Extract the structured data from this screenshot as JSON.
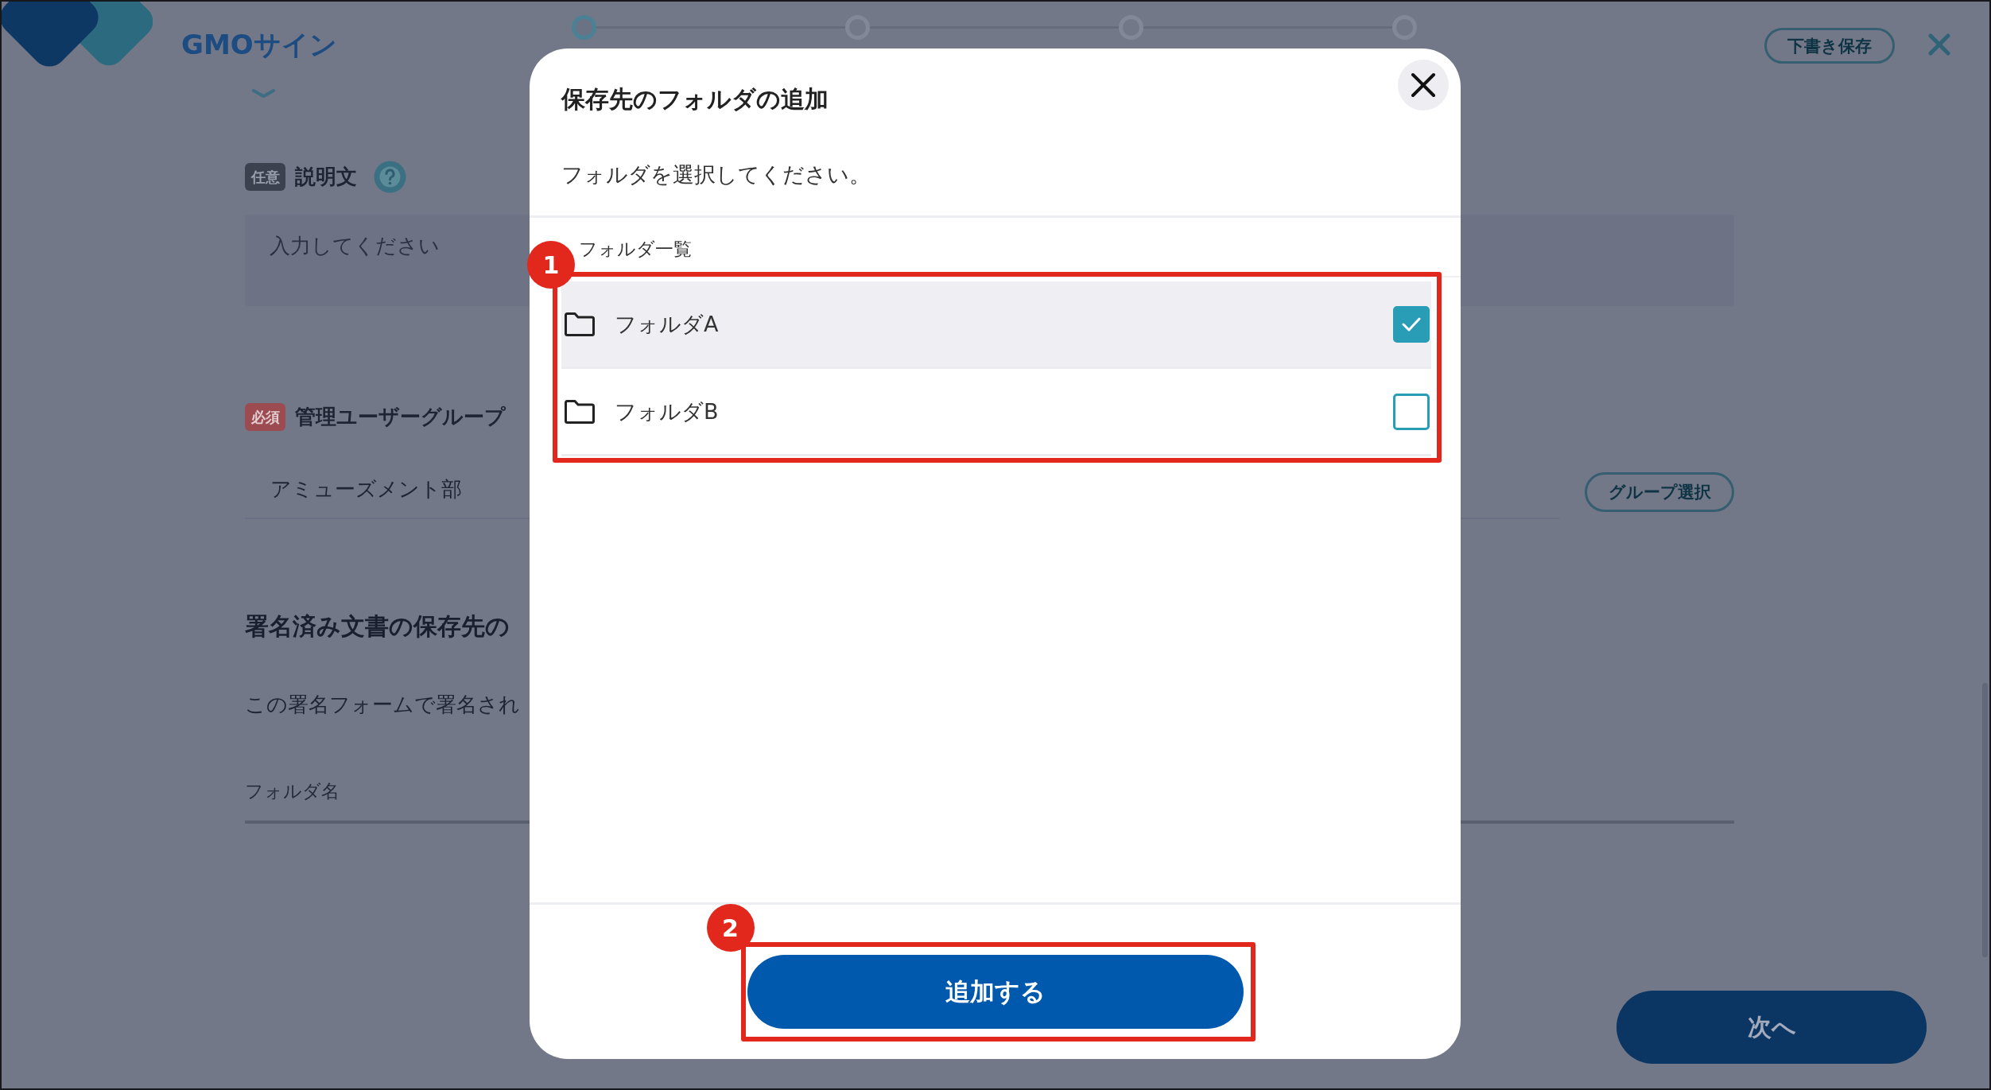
{
  "header": {
    "logo_text": "GMOサイン",
    "steps": [
      {
        "current": true
      },
      {
        "current": false
      },
      {
        "current": false
      },
      {
        "current": false
      }
    ],
    "draft_button": "下書き保存"
  },
  "form": {
    "description": {
      "badge": "任意",
      "required": false,
      "label": "説明文",
      "placeholder": "入力してください"
    },
    "admin_group": {
      "badge": "必須",
      "required": true,
      "label": "管理ユーザーグループ",
      "value": "アミューズメント部",
      "select_button": "グループ選択"
    },
    "save_location": {
      "heading": "署名済み文書の保存先の",
      "text": "この署名フォームで署名され",
      "folder_field": {
        "placeholder": "フォルダ名"
      }
    }
  },
  "next_button": "次へ",
  "dialog": {
    "title": "保存先のフォルダの追加",
    "instruction": "フォルダを選択してください。",
    "list_label": "フォルダ一覧",
    "folders": [
      {
        "name": "フォルダA",
        "checked": true
      },
      {
        "name": "フォルダB",
        "checked": false
      }
    ],
    "add_button": "追加する"
  },
  "callouts": [
    {
      "number": "1"
    },
    {
      "number": "2"
    }
  ]
}
